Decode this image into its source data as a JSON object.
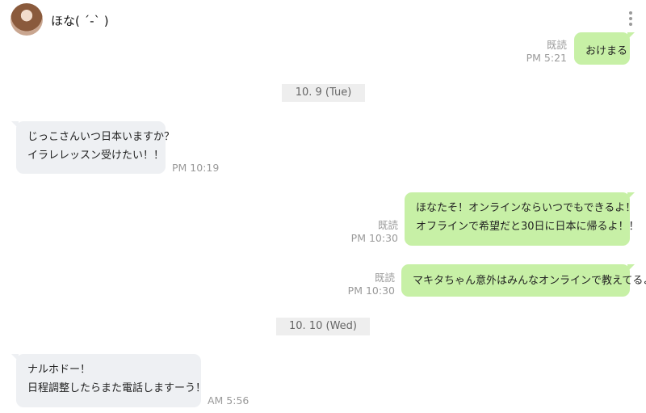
{
  "header": {
    "contact_name": "ほな( ´-` )",
    "avatar_icon": "profile-photo",
    "menu_icon": "kebab-menu-icon"
  },
  "colors": {
    "outgoing_bubble": "#c7f0a6",
    "incoming_bubble": "#eef0f3",
    "meta_text": "#9a9a9a"
  },
  "messages": {
    "m1": {
      "direction": "out",
      "read_label": "既読",
      "time": "PM 5:21",
      "lines": [
        "おけまる"
      ]
    },
    "divider1": {
      "label": "10. 9 (Tue)"
    },
    "m2": {
      "direction": "in",
      "time": "PM 10:19",
      "lines": [
        "じっこさんいつ日本いますか？",
        "イラレレッスン受けたい！！"
      ]
    },
    "m3": {
      "direction": "out",
      "read_label": "既読",
      "time": "PM 10:30",
      "lines": [
        "ほなたそ！オンラインならいつでもできるよ！",
        "オフラインで希望だと30日に日本に帰るよ！！"
      ]
    },
    "m4": {
      "direction": "out",
      "read_label": "既読",
      "time": "PM 10:30",
      "lines": [
        "マキタちゃん意外はみんなオンラインで教えてるよ"
      ]
    },
    "divider2": {
      "label": "10. 10 (Wed)"
    },
    "m5": {
      "direction": "in",
      "time": "AM 5:56",
      "lines": [
        "ナルホドー！",
        "日程調整したらまた電話しますーう！"
      ]
    }
  }
}
